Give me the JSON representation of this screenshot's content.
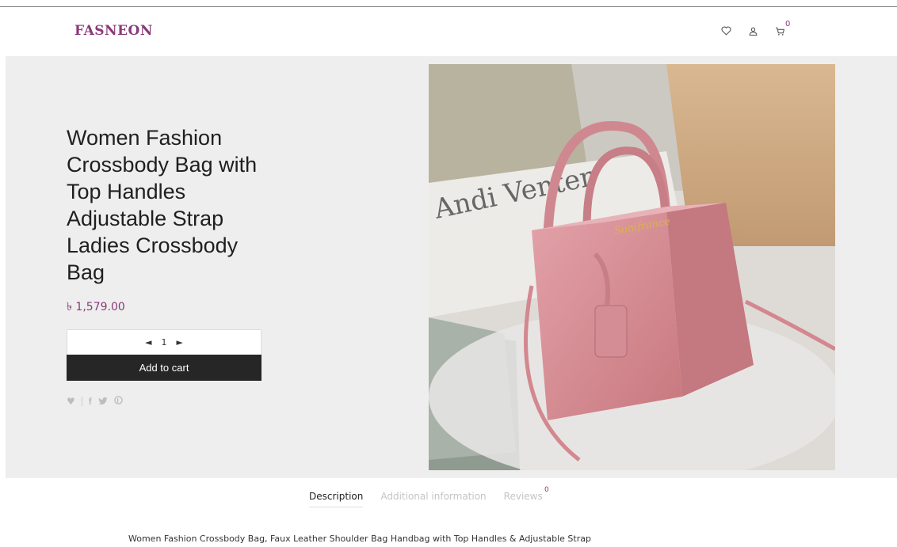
{
  "header": {
    "logo_text": "FASNEON",
    "cart_count": "0",
    "icons": [
      "heart-icon",
      "user-icon",
      "cart-icon"
    ]
  },
  "product": {
    "title": "Women Fashion Crossbody Bag with Top Handles Adjustable Strap Ladies Crossbody Bag",
    "price": "৳ 1,579.00",
    "quantity": "1",
    "add_to_cart_label": "Add to cart",
    "image_sign_text": "Andi Venter",
    "bag_logo_text": "Sonifrance"
  },
  "share": {
    "icons": [
      "heart-icon",
      "facebook-icon",
      "twitter-icon",
      "pinterest-icon"
    ]
  },
  "tabs": [
    {
      "label": "Description",
      "active": true
    },
    {
      "label": "Additional information",
      "active": false
    },
    {
      "label": "Reviews",
      "count": "0",
      "active": false
    }
  ],
  "description": "Women Fashion Crossbody Bag, Faux Leather Shoulder Bag Handbag with Top Handles & Adjustable Strap",
  "colors": {
    "accent": "#8a3a78",
    "button_bg": "#262626",
    "hero_bg": "#eeeeee",
    "bag": "#d88f98"
  }
}
